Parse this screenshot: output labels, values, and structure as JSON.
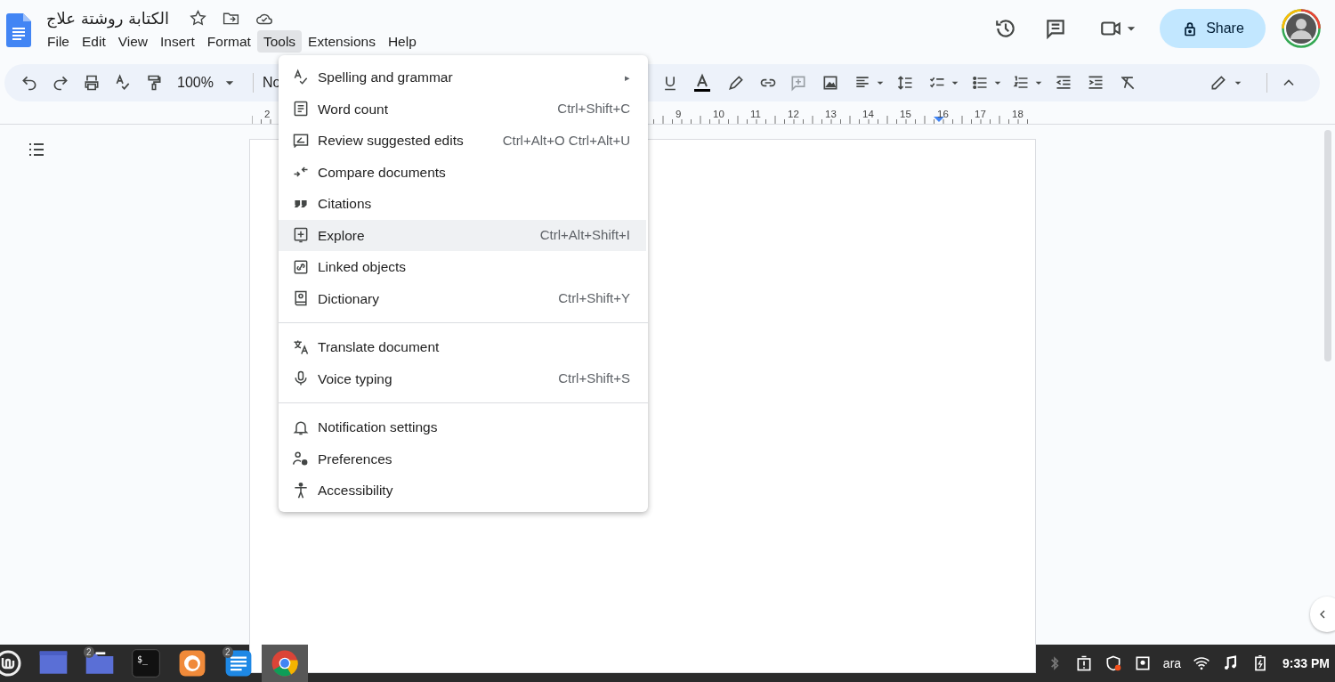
{
  "document": {
    "title": "الكتابة روشتة علاج"
  },
  "menu_bar": [
    {
      "label": "File",
      "selected": false
    },
    {
      "label": "Edit",
      "selected": false
    },
    {
      "label": "View",
      "selected": false
    },
    {
      "label": "Insert",
      "selected": false
    },
    {
      "label": "Format",
      "selected": false
    },
    {
      "label": "Tools",
      "selected": true
    },
    {
      "label": "Extensions",
      "selected": false
    },
    {
      "label": "Help",
      "selected": false
    }
  ],
  "share_button": {
    "label": "Share"
  },
  "toolbar": {
    "zoom": "100%",
    "style_partial": "No"
  },
  "ruler": {
    "labels": [
      "2",
      "9",
      "10",
      "11",
      "12",
      "13",
      "14",
      "15",
      "16",
      "17",
      "18"
    ]
  },
  "tools_menu": [
    {
      "label": "Spelling and grammar",
      "submenu_arrow": "▸",
      "selected": false,
      "separator_before": false
    },
    {
      "label": "Word count",
      "shortcut": "Ctrl+Shift+C",
      "selected": false,
      "separator_before": false
    },
    {
      "label": "Review suggested edits",
      "shortcut": "Ctrl+Alt+O Ctrl+Alt+U",
      "selected": false,
      "separator_before": false
    },
    {
      "label": "Compare documents",
      "selected": false,
      "separator_before": false
    },
    {
      "label": "Citations",
      "selected": false,
      "separator_before": false
    },
    {
      "label": "Explore",
      "shortcut": "Ctrl+Alt+Shift+I",
      "selected": true,
      "separator_before": false
    },
    {
      "label": "Linked objects",
      "selected": false,
      "separator_before": false
    },
    {
      "label": "Dictionary",
      "shortcut": "Ctrl+Shift+Y",
      "selected": false,
      "separator_before": false
    },
    {
      "label": "Translate document",
      "selected": false,
      "separator_before": true
    },
    {
      "label": "Voice typing",
      "shortcut": "Ctrl+Shift+S",
      "selected": false,
      "separator_before": false
    },
    {
      "label": "Notification settings",
      "selected": false,
      "separator_before": true
    },
    {
      "label": "Preferences",
      "selected": false,
      "separator_before": false
    },
    {
      "label": "Accessibility",
      "selected": false,
      "separator_before": false
    }
  ],
  "taskbar": {
    "apps": [
      {
        "kind": "window",
        "selected": false
      },
      {
        "kind": "folder",
        "badge": "2",
        "selected": false
      },
      {
        "kind": "terminal",
        "label": "$_",
        "selected": false
      },
      {
        "kind": "firefox",
        "selected": false
      },
      {
        "kind": "notes",
        "badge": "2",
        "selected": false
      },
      {
        "kind": "chrome",
        "selected": true
      }
    ],
    "language": "ara",
    "clock": "9:33 PM"
  }
}
